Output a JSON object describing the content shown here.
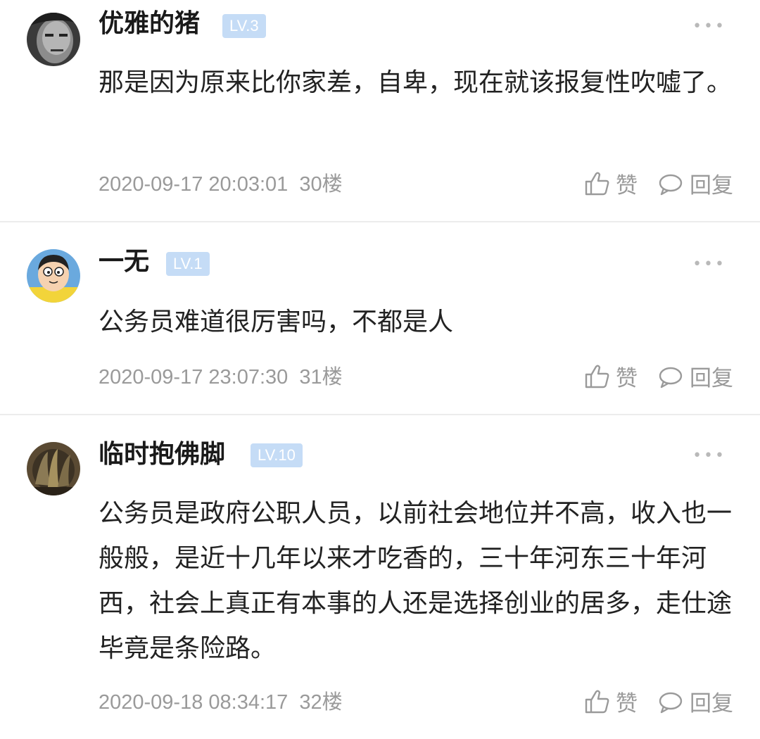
{
  "comments": [
    {
      "username": "优雅的猪",
      "level": "LV.3",
      "more_icon": "ellipsis-icon",
      "content": "那是因为原来比你家差，自卑，现在就该报复性吹嘘了。",
      "timestamp": "2020-09-17 20:03:01",
      "floor": "30楼",
      "like_label": "赞",
      "reply_label": "回复"
    },
    {
      "username": "一无",
      "level": "LV.1",
      "more_icon": "ellipsis-icon",
      "content": "公务员难道很厉害吗，不都是人",
      "timestamp": "2020-09-17 23:07:30",
      "floor": "31楼",
      "like_label": "赞",
      "reply_label": "回复"
    },
    {
      "username": "临时抱佛脚",
      "level": "LV.10",
      "more_icon": "ellipsis-icon",
      "content": "公务员是政府公职人员，以前社会地位并不高，收入也一般般，是近十几年以来才吃香的，三十年河东三十年河西，社会上真正有本事的人还是选择创业的居多，走仕途毕竟是条险路。",
      "timestamp": "2020-09-18 08:34:17",
      "floor": "32楼",
      "like_label": "赞",
      "reply_label": "回复"
    }
  ],
  "colors": {
    "level_badge_bg": "#c5dcf6",
    "meta_text": "#9a9a9a",
    "divider": "#ececec"
  }
}
